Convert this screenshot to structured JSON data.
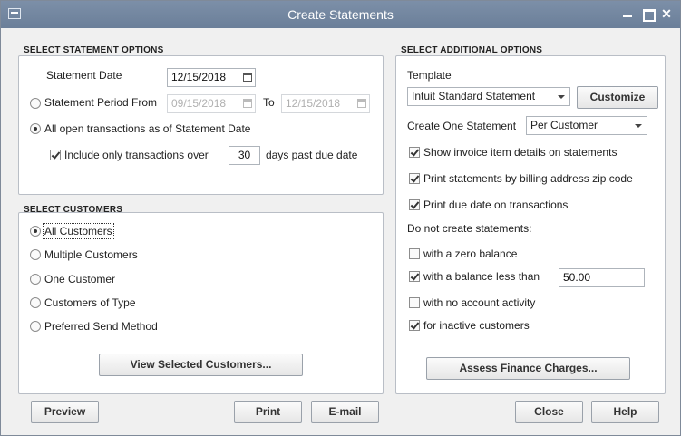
{
  "window": {
    "title": "Create Statements"
  },
  "statement_options": {
    "heading": "SELECT STATEMENT OPTIONS",
    "statement_date_label": "Statement Date",
    "statement_date": "12/15/2018",
    "period_label": "Statement Period From",
    "period_from": "09/15/2018",
    "to_label": "To",
    "period_to": "12/15/2018",
    "all_open_label": "All open transactions as of Statement Date",
    "include_only_label": "Include only transactions over",
    "days_value": "30",
    "days_label": "days past due date"
  },
  "customers": {
    "heading": "SELECT CUSTOMERS",
    "options": [
      "All Customers",
      "Multiple Customers",
      "One Customer",
      "Customers of Type",
      "Preferred Send Method"
    ],
    "selected": "All Customers",
    "view_button": "View Selected Customers..."
  },
  "additional": {
    "heading": "SELECT ADDITIONAL OPTIONS",
    "template_label": "Template",
    "template_value": "Intuit Standard Statement",
    "customize_button": "Customize",
    "create_one_label": "Create One Statement",
    "create_one_value": "Per Customer",
    "show_invoice": "Show invoice item details on statements",
    "print_by_zip": "Print statements by billing address zip code",
    "print_due_date": "Print due date on transactions",
    "do_not_create": "Do not create statements:",
    "zero_balance": "with a zero balance",
    "balance_less_than": "with a balance less than",
    "balance_value": "50.00",
    "no_activity": "with no account activity",
    "inactive": "for inactive customers",
    "finance_button": "Assess Finance Charges..."
  },
  "footer": {
    "preview": "Preview",
    "print": "Print",
    "email": "E-mail",
    "close": "Close",
    "help": "Help"
  }
}
